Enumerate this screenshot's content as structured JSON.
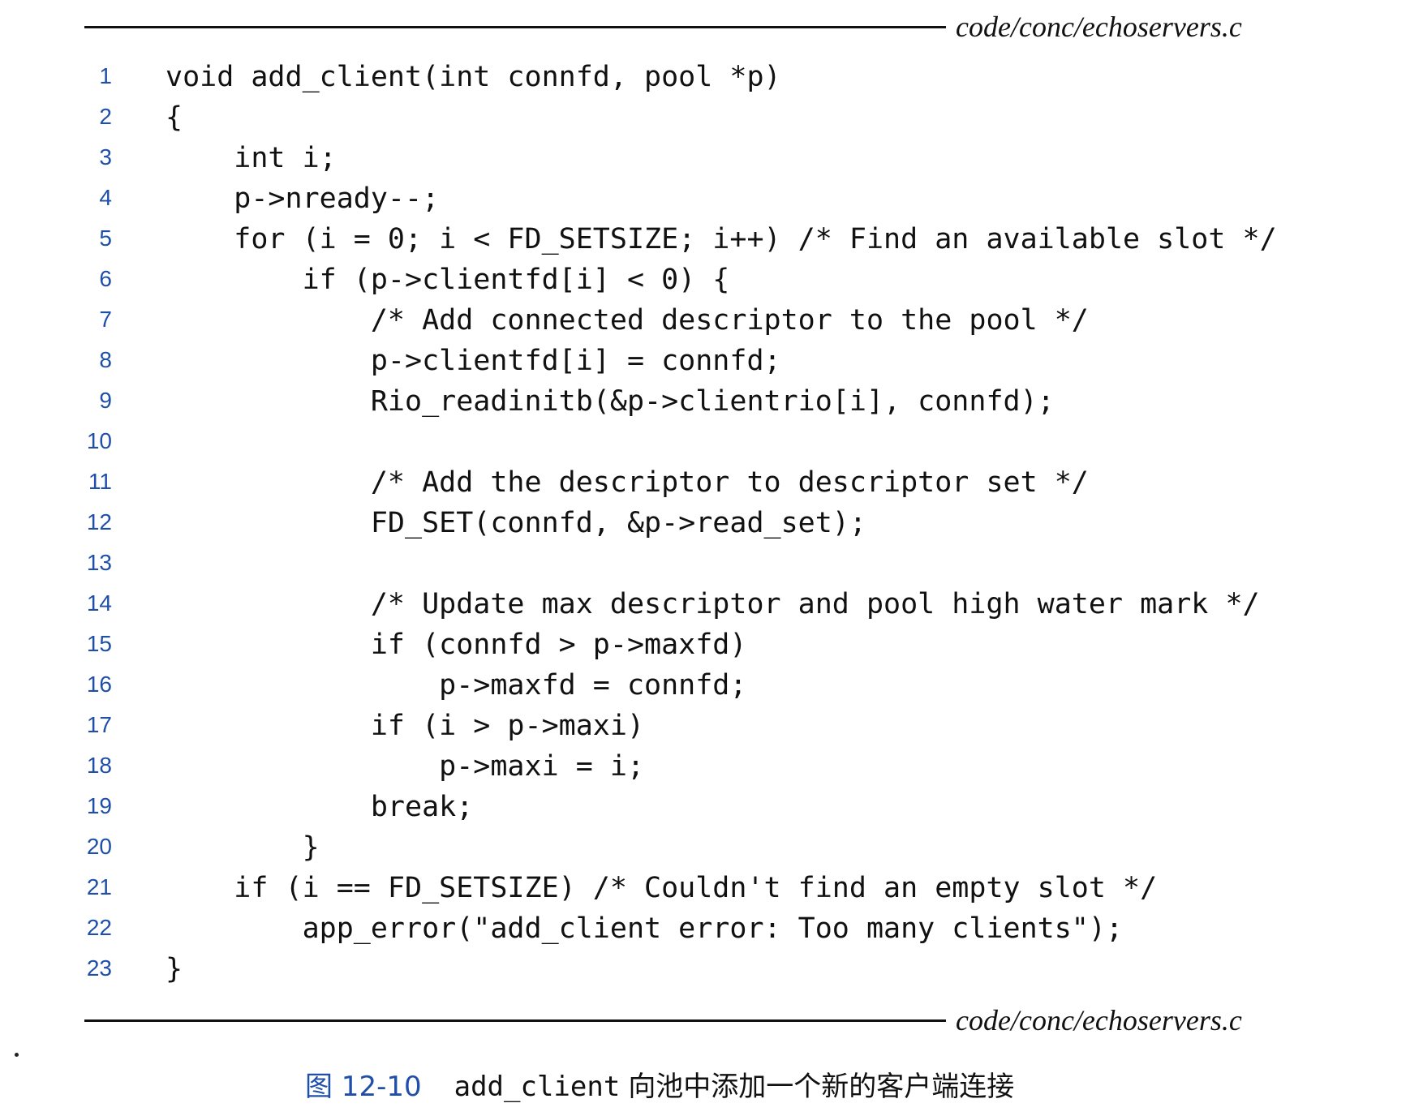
{
  "header": {
    "filename": "code/conc/echoservers.c"
  },
  "footer": {
    "filename": "code/conc/echoservers.c"
  },
  "code": {
    "lines": [
      {
        "num": "1",
        "text": "void add_client(int connfd, pool *p)"
      },
      {
        "num": "2",
        "text": "{"
      },
      {
        "num": "3",
        "text": "    int i;"
      },
      {
        "num": "4",
        "text": "    p->nready--;"
      },
      {
        "num": "5",
        "text": "    for (i = 0; i < FD_SETSIZE; i++) /* Find an available slot */"
      },
      {
        "num": "6",
        "text": "        if (p->clientfd[i] < 0) {"
      },
      {
        "num": "7",
        "text": "            /* Add connected descriptor to the pool */"
      },
      {
        "num": "8",
        "text": "            p->clientfd[i] = connfd;"
      },
      {
        "num": "9",
        "text": "            Rio_readinitb(&p->clientrio[i], connfd);"
      },
      {
        "num": "10",
        "text": ""
      },
      {
        "num": "11",
        "text": "            /* Add the descriptor to descriptor set */"
      },
      {
        "num": "12",
        "text": "            FD_SET(connfd, &p->read_set);"
      },
      {
        "num": "13",
        "text": ""
      },
      {
        "num": "14",
        "text": "            /* Update max descriptor and pool high water mark */"
      },
      {
        "num": "15",
        "text": "            if (connfd > p->maxfd)"
      },
      {
        "num": "16",
        "text": "                p->maxfd = connfd;"
      },
      {
        "num": "17",
        "text": "            if (i > p->maxi)"
      },
      {
        "num": "18",
        "text": "                p->maxi = i;"
      },
      {
        "num": "19",
        "text": "            break;"
      },
      {
        "num": "20",
        "text": "        }"
      },
      {
        "num": "21",
        "text": "    if (i == FD_SETSIZE) /* Couldn't find an empty slot */"
      },
      {
        "num": "22",
        "text": "        app_error(\"add_client error: Too many clients\");"
      },
      {
        "num": "23",
        "text": "}"
      }
    ]
  },
  "caption": {
    "label": "图 12-10",
    "function": "add_client",
    "text": "向池中添加一个新的客户端连接"
  }
}
